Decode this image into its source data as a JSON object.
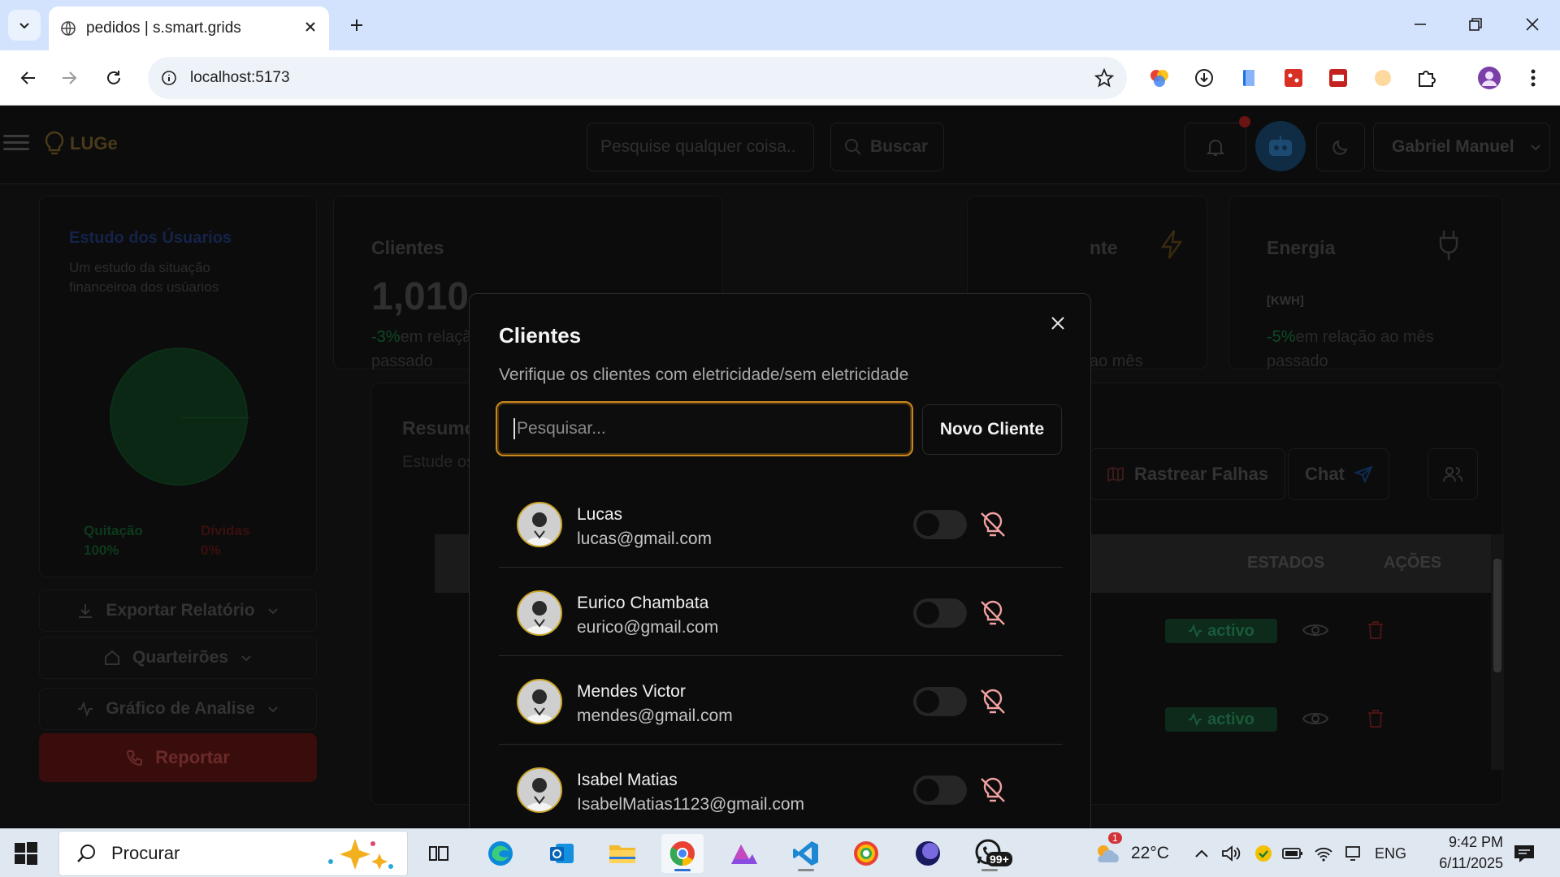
{
  "browser": {
    "tab_title": "pedidos | s.smart.grids",
    "url": "localhost:5173"
  },
  "app": {
    "logo": "LUGe",
    "search_placeholder": "Pesquise qualquer coisa..",
    "search_button": "Buscar",
    "user_name": "Gabriel Manuel",
    "sidebar": {
      "title": "Estudo dos Úsuarios",
      "subtitle": "Um estudo da situação financeiroa dos usúarios",
      "legend_paid_label": "Quitação",
      "legend_paid_value": "100%",
      "legend_debt_label": "Dívidas",
      "legend_debt_value": "0%",
      "export_button": "Exportar Relatório",
      "blocks_button": "Quarteirões",
      "chart_button": "Gráfico de Analise",
      "report_button": "Reportar"
    },
    "stats": {
      "clients_label": "Clientes",
      "clients_value": "1,010",
      "clients_change": "-3%",
      "clients_change_text": "em relação ao mês passado",
      "middle_label_fragment": "nte",
      "middle_change_fragment": "ao mês",
      "energy_label": "Energia",
      "energy_unit": "[KWH]",
      "energy_change": "-5%",
      "energy_change_text": "em relação ao mês passado"
    },
    "main": {
      "title_fragment": "Resumo",
      "subtitle_fragment": "Estude os",
      "track_faults_button": "Rastrear Falhas",
      "chat_button": "Chat",
      "col_states": "ESTADOS",
      "col_actions": "AÇÕES",
      "rows": [
        {
          "status": "activo"
        },
        {
          "status": "activo"
        }
      ]
    }
  },
  "modal": {
    "title": "Clientes",
    "description": "Verifique os clientes com eletricidade/sem eletricidade",
    "search_placeholder": "Pesquisar...",
    "new_client_button": "Novo Cliente",
    "clients": [
      {
        "name": "Lucas",
        "email": "lucas@gmail.com",
        "power_on": false
      },
      {
        "name": "Eurico Chambata",
        "email": "eurico@gmail.com",
        "power_on": false
      },
      {
        "name": "Mendes Victor",
        "email": "mendes@gmail.com",
        "power_on": false
      },
      {
        "name": "Isabel Matias",
        "email": "IsabelMatias1123@gmail.com",
        "power_on": false
      }
    ]
  },
  "taskbar": {
    "search_label": "Procurar",
    "weather_temp": "22°C",
    "weather_badge": "1",
    "language": "ENG",
    "time": "9:42 PM",
    "date": "6/11/2025",
    "whatsapp_badge": "99+"
  },
  "colors": {
    "modal_focus_ring": "#c9871a",
    "bulb_off": "#f0a0a0",
    "status_active": "#1a5a38"
  }
}
